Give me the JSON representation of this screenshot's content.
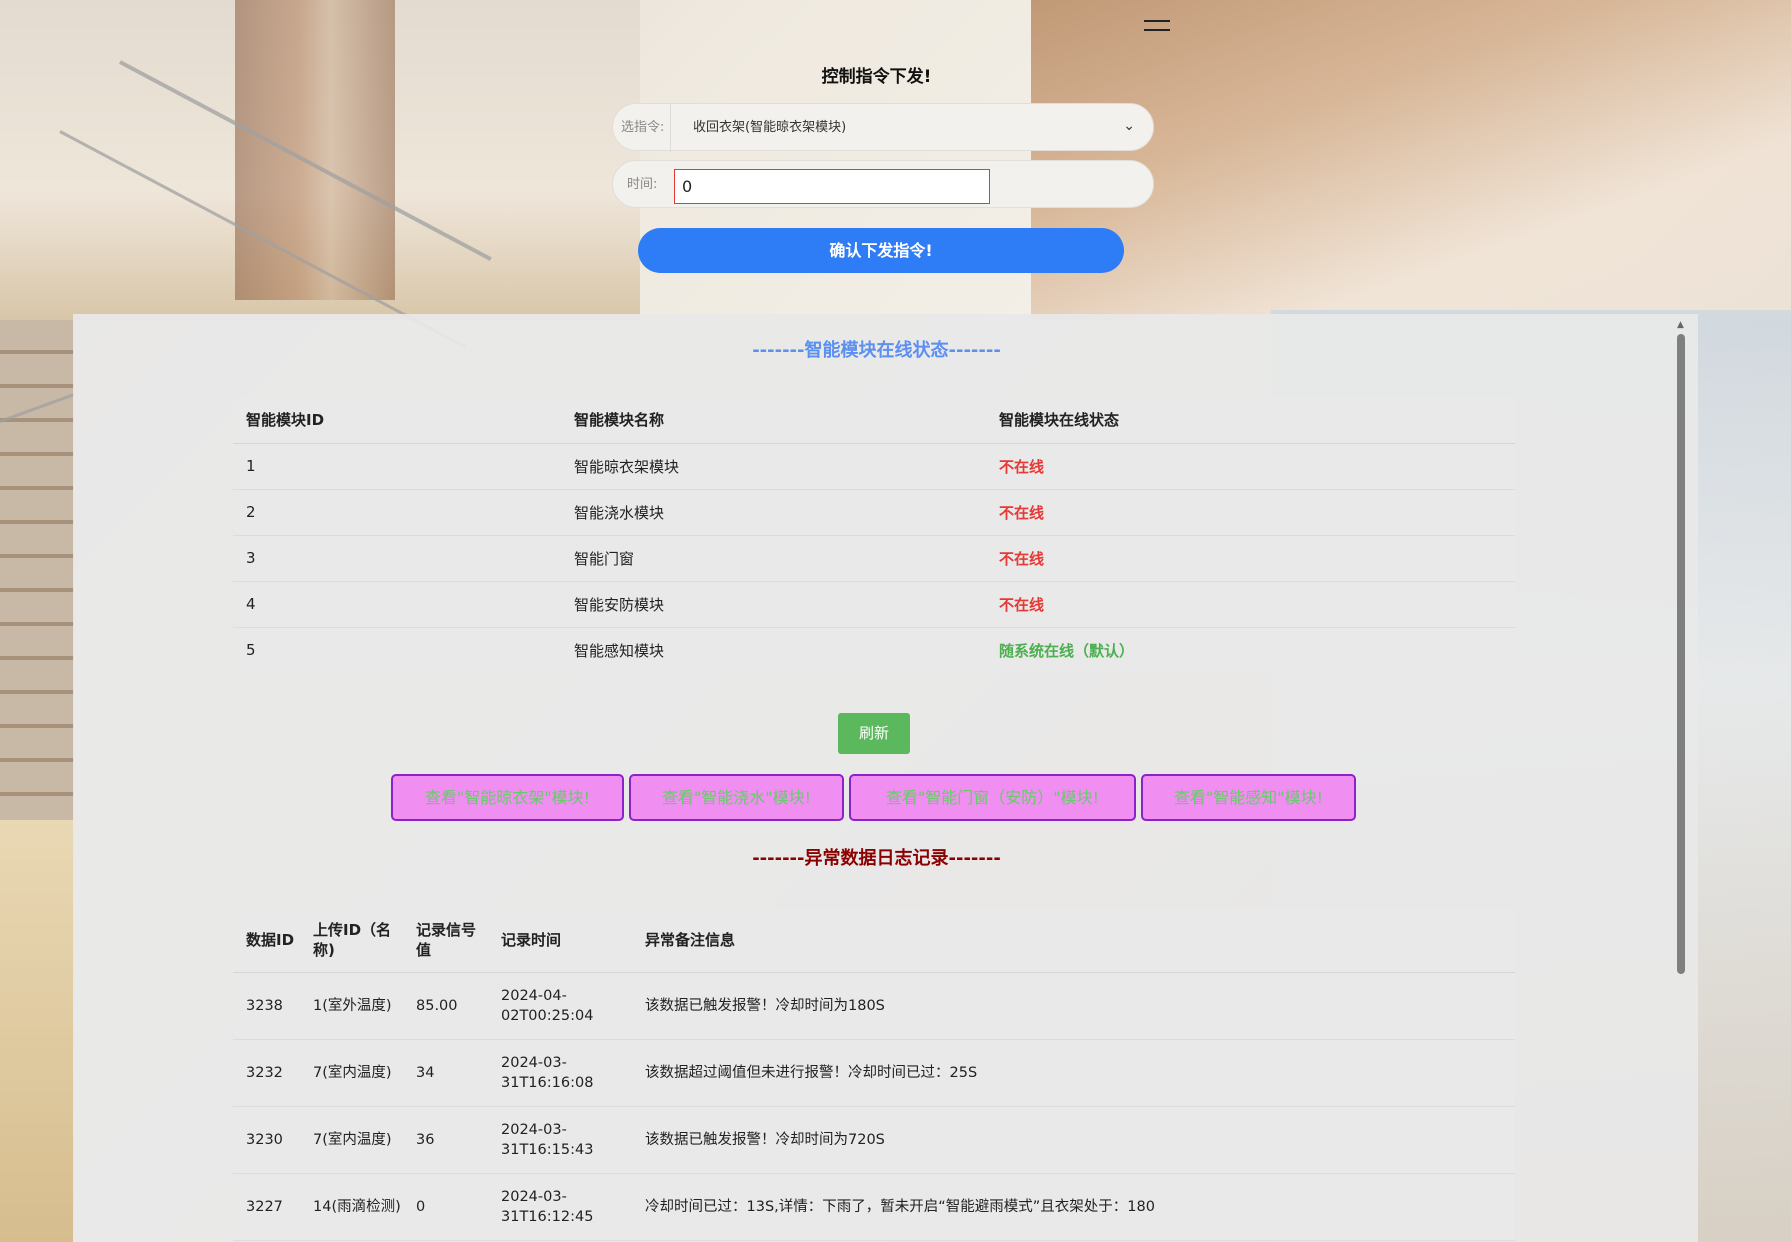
{
  "command": {
    "title": "控制指令下发!",
    "select_label": "选指令:",
    "select_value": "收回衣架(智能晾衣架模块)",
    "time_label": "时间:",
    "time_value": "0",
    "confirm_label": "确认下发指令!"
  },
  "status": {
    "title": "-------智能模块在线状态-------",
    "headers": [
      "智能模块ID",
      "智能模块名称",
      "智能模块在线状态"
    ],
    "rows": [
      {
        "id": "1",
        "name": "智能晾衣架模块",
        "state": "不在线"
      },
      {
        "id": "2",
        "name": "智能浇水模块",
        "state": "不在线"
      },
      {
        "id": "3",
        "name": "智能门窗",
        "state": "不在线"
      },
      {
        "id": "4",
        "name": "智能安防模块",
        "state": "不在线"
      },
      {
        "id": "5",
        "name": "智能感知模块",
        "state": "随系统在线（默认）"
      }
    ],
    "colors": {
      "offline": "#e53935",
      "online": "#4caf50"
    }
  },
  "refresh_label": "刷新",
  "module_buttons": [
    "查看\"智能晾衣架\"模块!",
    "查看\"智能浇水\"模块!",
    "查看\"智能门窗（安防）\"模块!",
    "查看\"智能感知\"模块!"
  ],
  "log": {
    "title": "-------异常数据日志记录-------",
    "headers": [
      "数据ID",
      "上传ID（名称)",
      "记录信号值",
      "记录时间",
      "异常备注信息"
    ],
    "rows": [
      {
        "data_id": "3238",
        "upload": "1(室外温度)",
        "value": "85.00",
        "time": "2024-04-02T00:25:04",
        "note": "该数据已触发报警！冷却时间为180S"
      },
      {
        "data_id": "3232",
        "upload": "7(室内温度)",
        "value": "34",
        "time": "2024-03-31T16:16:08",
        "note": "该数据超过阈值但未进行报警！冷却时间已过：25S"
      },
      {
        "data_id": "3230",
        "upload": "7(室内温度)",
        "value": "36",
        "time": "2024-03-31T16:15:43",
        "note": "该数据已触发报警！冷却时间为720S"
      },
      {
        "data_id": "3227",
        "upload": "14(雨滴检测)",
        "value": "0",
        "time": "2024-03-31T16:12:45",
        "note": "冷却时间已过：13S,详情：下雨了，暂未开启“智能避雨模式”且衣架处于：180"
      }
    ]
  },
  "accent": "#2e7cf6"
}
